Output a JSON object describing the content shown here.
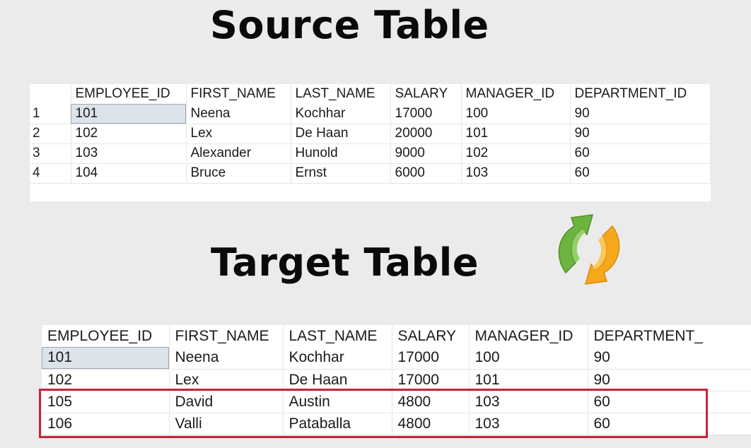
{
  "source": {
    "title": "Source Table",
    "columns": [
      "EMPLOYEE_ID",
      "FIRST_NAME",
      "LAST_NAME",
      "SALARY",
      "MANAGER_ID",
      "DEPARTMENT_ID"
    ],
    "rows": [
      {
        "num": "1",
        "cells": [
          "101",
          "Neena",
          "Kochhar",
          "17000",
          "100",
          "90"
        ]
      },
      {
        "num": "2",
        "cells": [
          "102",
          "Lex",
          "De Haan",
          "20000",
          "101",
          "90"
        ]
      },
      {
        "num": "3",
        "cells": [
          "103",
          "Alexander",
          "Hunold",
          "9000",
          "102",
          "60"
        ]
      },
      {
        "num": "4",
        "cells": [
          "104",
          "Bruce",
          "Ernst",
          "6000",
          "103",
          "60"
        ]
      }
    ]
  },
  "target": {
    "title": "Target Table",
    "columns": [
      "EMPLOYEE_ID",
      "FIRST_NAME",
      "LAST_NAME",
      "SALARY",
      "MANAGER_ID",
      "DEPARTMENT_"
    ],
    "rows": [
      {
        "cells": [
          "101",
          "Neena",
          "Kochhar",
          "17000",
          "100",
          "90"
        ]
      },
      {
        "cells": [
          "102",
          "Lex",
          "De Haan",
          "17000",
          "101",
          "90"
        ]
      },
      {
        "cells": [
          "105",
          "David",
          "Austin",
          "4800",
          "103",
          "60"
        ]
      },
      {
        "cells": [
          "106",
          "Valli",
          "Pataballa",
          "4800",
          "103",
          "60"
        ]
      }
    ]
  },
  "icons": {
    "sync": "sync-arrows-icon"
  },
  "colors": {
    "highlight_border": "#c0283a",
    "selected_cell": "#dde3eb",
    "arrow_green": "#6cb33f",
    "arrow_orange": "#f6a81c"
  }
}
